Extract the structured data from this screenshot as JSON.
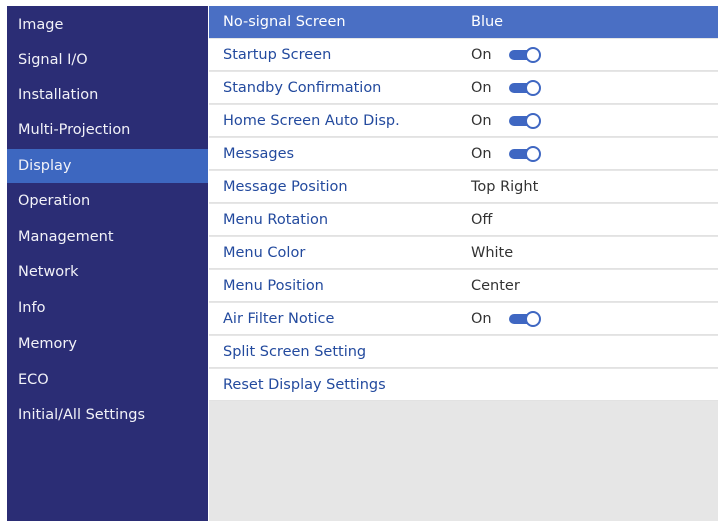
{
  "sidebar": {
    "items": [
      {
        "label": "Image"
      },
      {
        "label": "Signal I/O"
      },
      {
        "label": "Installation"
      },
      {
        "label": "Multi-Projection"
      },
      {
        "label": "Display",
        "selected": true
      },
      {
        "label": "Operation"
      },
      {
        "label": "Management"
      },
      {
        "label": "Network"
      },
      {
        "label": "Info"
      },
      {
        "label": "Memory"
      },
      {
        "label": "ECO"
      },
      {
        "label": "Initial/All Settings"
      }
    ]
  },
  "settings": {
    "rows": [
      {
        "label": "No-signal Screen",
        "value": "Blue",
        "selected": true
      },
      {
        "label": "Startup Screen",
        "value": "On",
        "toggle": true
      },
      {
        "label": "Standby Confirmation",
        "value": "On",
        "toggle": true
      },
      {
        "label": "Home Screen Auto Disp.",
        "value": "On",
        "toggle": true
      },
      {
        "label": "Messages",
        "value": "On",
        "toggle": true
      },
      {
        "label": "Message Position",
        "value": "Top Right"
      },
      {
        "label": "Menu Rotation",
        "value": "Off"
      },
      {
        "label": "Menu Color",
        "value": "White"
      },
      {
        "label": "Menu Position",
        "value": "Center"
      },
      {
        "label": "Air Filter Notice",
        "value": "On",
        "toggle": true
      },
      {
        "label": "Split Screen Setting",
        "value": ""
      },
      {
        "label": "Reset Display Settings",
        "value": ""
      }
    ]
  },
  "colors": {
    "sidebar_bg": "#2b2d75",
    "sidebar_selected": "#3d67c0",
    "row_selected": "#4a6fc4",
    "label_text": "#234a9e",
    "toggle_accent": "#3f67c2"
  }
}
